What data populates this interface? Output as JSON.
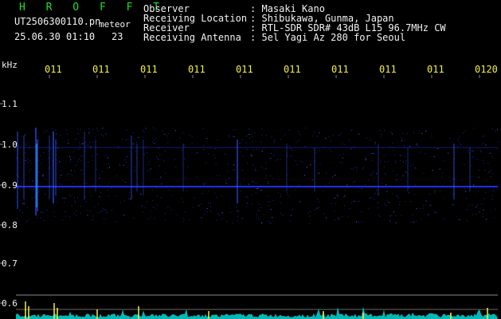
{
  "header": {
    "app_title": "H R O F F T",
    "filename": "UT2506300110.pn",
    "meteor_label": "meteor",
    "datetime": "25.06.30 01:10",
    "meteor_count": "23"
  },
  "info": [
    {
      "key": "Observer",
      "sep": ":",
      "value": "Masaki Kano"
    },
    {
      "key": "Receiving Location",
      "sep": ":",
      "value": "Shibukawa, Gunma, Japan"
    },
    {
      "key": "Receiver",
      "sep": ":",
      "value": "RTL-SDR SDR# 43dB L15 96.7MHz CW"
    },
    {
      "key": "Receiving Antenna",
      "sep": ":",
      "value": "5el Yagi Az 280 for Seoul"
    }
  ],
  "axes": {
    "y_unit": "kHz",
    "x_ticks": [
      "011",
      "011",
      "011",
      "011",
      "011",
      "011",
      "011",
      "011",
      "011",
      "0120"
    ],
    "y_ticks": [
      "1.1",
      "1.0",
      "0.9",
      "0.8",
      "0.7",
      "0.6"
    ]
  },
  "colors": {
    "background": "#000000",
    "title": "#22dd22",
    "label": "#f2f2f2",
    "accent": "#f4f040",
    "signal": "#2233ff",
    "noise": "#00cccc"
  }
}
